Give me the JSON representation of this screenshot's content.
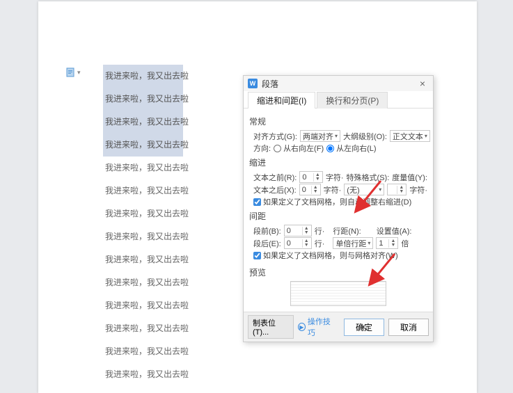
{
  "doc": {
    "line_text": "我进来啦，我又出去啦",
    "selected_count": 4,
    "total_lines": 14
  },
  "dialog": {
    "title": "段落",
    "tabs": {
      "indent": "缩进和间距(I)",
      "page": "换行和分页(P)"
    },
    "general_hdr": "常规",
    "align_label": "对齐方式(G):",
    "align_value": "两端对齐",
    "outline_label": "大纲级别(O):",
    "outline_value": "正文文本",
    "direction_label": "方向:",
    "dir_rtl": "从右向左(F)",
    "dir_ltr": "从左向右(L)",
    "indent_hdr": "缩进",
    "before_text_label": "文本之前(R):",
    "before_text_val": "0",
    "after_text_label": "文本之后(X):",
    "after_text_val": "0",
    "char_unit": "字符·",
    "special_label": "特殊格式(S):",
    "special_value": "(无)",
    "measure_label": "度量值(Y):",
    "measure_value": "",
    "auto_indent_chk": "如果定义了文档网格，则自动调整右缩进(D)",
    "spacing_hdr": "间距",
    "space_before_label": "段前(B):",
    "space_before_val": "0",
    "space_after_label": "段后(E):",
    "space_after_val": "0",
    "line_unit": "行·",
    "linespace_label": "行距(N):",
    "linespace_value": "单倍行距",
    "setvalue_label": "设置值(A):",
    "setvalue_val": "1",
    "mult_unit": "倍",
    "snap_chk": "如果定义了文档网格，则与网格对齐(W)",
    "preview_hdr": "预览",
    "tabstops_btn": "制表位(T)...",
    "tips_label": "操作技巧",
    "ok_btn": "确定",
    "cancel_btn": "取消"
  }
}
